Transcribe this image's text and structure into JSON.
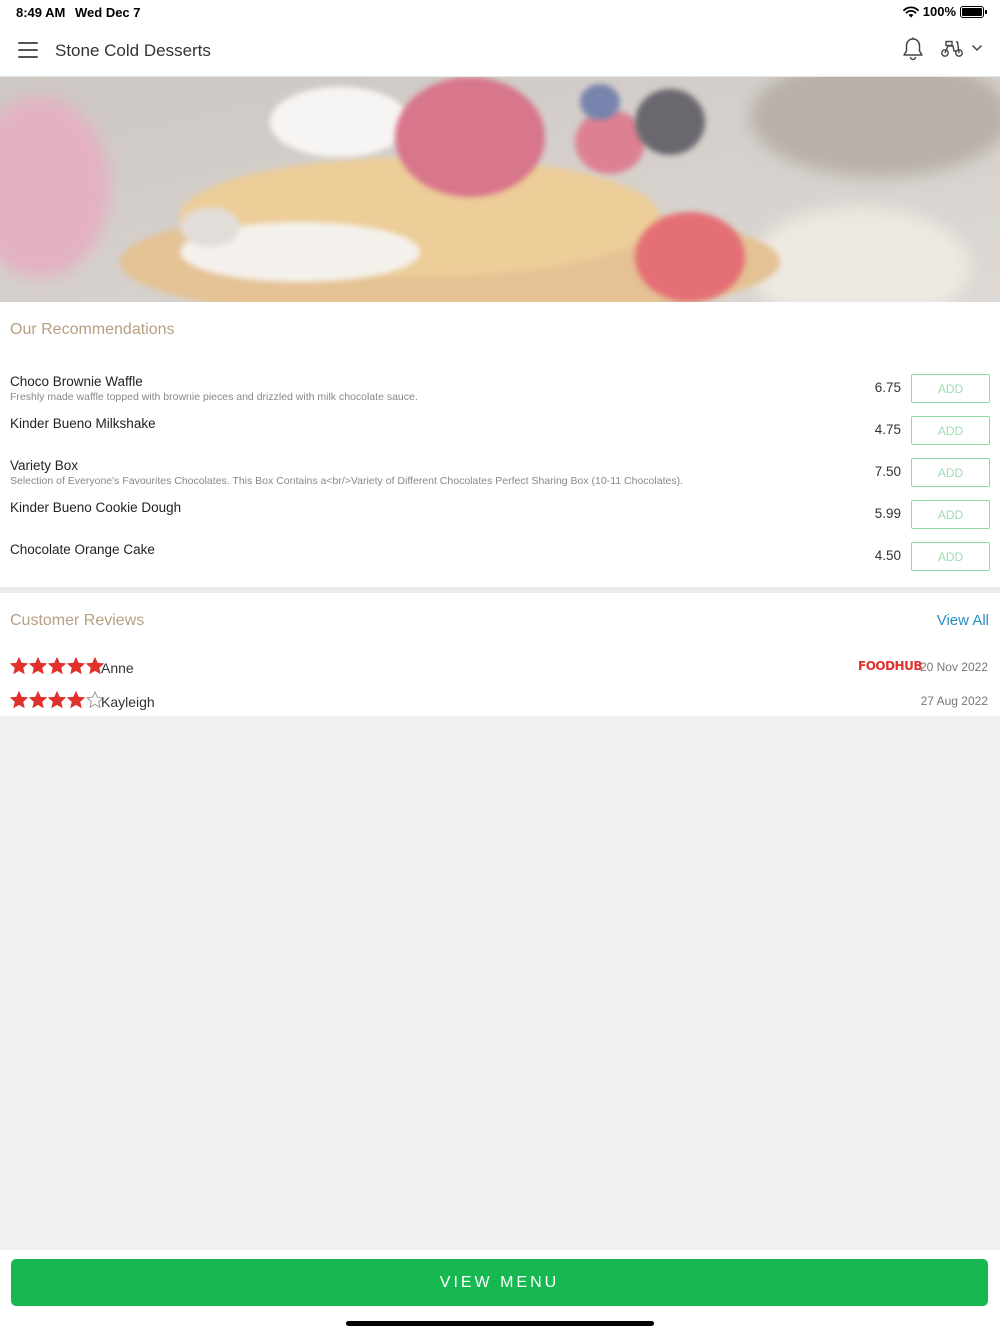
{
  "status_bar": {
    "time": "8:49 AM",
    "date": "Wed Dec 7",
    "battery": "100%",
    "icons": [
      "wifi-icon",
      "battery-icon"
    ]
  },
  "header": {
    "title": "Stone Cold Desserts",
    "icons": [
      "menu-icon",
      "bell-icon",
      "scooter-icon",
      "chevron-down-icon"
    ]
  },
  "recommendations": {
    "title": "Our Recommendations",
    "add_label": "ADD",
    "items": [
      {
        "name": "Choco Brownie Waffle",
        "description": "Freshly made waffle topped with brownie pieces and drizzled with milk chocolate sauce.",
        "price": "6.75"
      },
      {
        "name": "Kinder Bueno Milkshake",
        "description": "",
        "price": "4.75"
      },
      {
        "name": "Variety Box",
        "description": "Selection of Everyone's Favourites Chocolates. This Box Contains a<br/>Variety of Different Chocolates Perfect Sharing Box (10-11 Chocolates).",
        "price": "7.50"
      },
      {
        "name": "Kinder Bueno Cookie Dough",
        "description": "",
        "price": "5.99"
      },
      {
        "name": "Chocolate Orange Cake",
        "description": "",
        "price": "4.50"
      }
    ]
  },
  "reviews": {
    "title": "Customer Reviews",
    "view_all": "View All",
    "items": [
      {
        "name": "Anne",
        "rating": 5,
        "source": "FOODHUB",
        "date": "20 Nov 2022"
      },
      {
        "name": "Kayleigh",
        "rating": 4,
        "source": "",
        "date": "27 Aug 2022"
      }
    ]
  },
  "footer": {
    "view_menu": "VIEW MENU"
  },
  "colors": {
    "accent_green": "#17b852",
    "section_title": "#b79f82",
    "link_blue": "#2a8fc5",
    "star_red": "#e0312c"
  }
}
